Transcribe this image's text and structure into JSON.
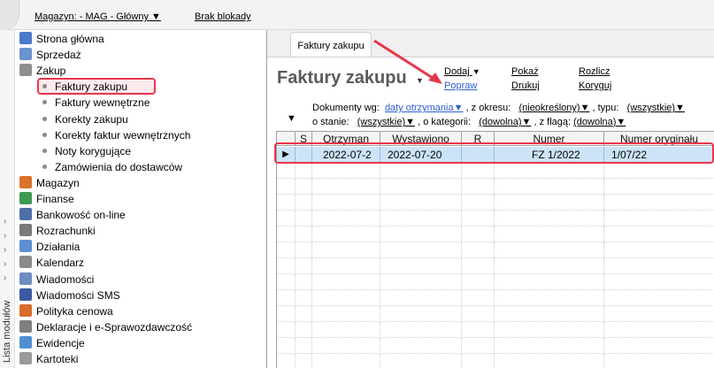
{
  "topbar": {
    "warehouse": "Magazyn: - MAG - Główny",
    "lock_status": "Brak blokady"
  },
  "sidebar": {
    "vertical_label": "Lista modułów",
    "items": [
      {
        "label": "Strona główna",
        "icon": "home-icon",
        "color": "#4a79c9"
      },
      {
        "label": "Sprzedaż",
        "icon": "sales-icon",
        "color": "#6b93cf"
      },
      {
        "label": "Zakup",
        "icon": "purchase-icon",
        "color": "#8f8f8f"
      },
      {
        "label": "Faktury zakupu",
        "child": true,
        "selected": true
      },
      {
        "label": "Faktury wewnętrzne",
        "child": true
      },
      {
        "label": "Korekty zakupu",
        "child": true
      },
      {
        "label": "Korekty faktur wewnętrznych",
        "child": true
      },
      {
        "label": "Noty korygujące",
        "child": true
      },
      {
        "label": "Zamówienia do dostawców",
        "child": true
      },
      {
        "label": "Magazyn",
        "icon": "warehouse-icon",
        "color": "#d9732c"
      },
      {
        "label": "Finanse",
        "icon": "finance-icon",
        "color": "#3d9a52"
      },
      {
        "label": "Bankowość on-line",
        "icon": "bank-icon",
        "color": "#4f6fa8"
      },
      {
        "label": "Rozrachunki",
        "icon": "settlements-icon",
        "color": "#7a7a7a"
      },
      {
        "label": "Działania",
        "icon": "actions-icon",
        "color": "#5b8fd0"
      },
      {
        "label": "Kalendarz",
        "icon": "calendar-icon",
        "color": "#8a8a8a"
      },
      {
        "label": "Wiadomości",
        "icon": "messages-icon",
        "color": "#6c8cc2"
      },
      {
        "label": "Wiadomości SMS",
        "icon": "sms-icon",
        "color": "#3b5aa0"
      },
      {
        "label": "Polityka cenowa",
        "icon": "pricing-icon",
        "color": "#d96b2c"
      },
      {
        "label": "Deklaracje i e-Sprawozdawczość",
        "icon": "declarations-icon",
        "color": "#7f7f7f"
      },
      {
        "label": "Ewidencje",
        "icon": "records-icon",
        "color": "#4f8fd0"
      },
      {
        "label": "Kartoteki",
        "icon": "files-icon",
        "color": "#9a9a9a"
      }
    ]
  },
  "tab": {
    "label": "Faktury zakupu"
  },
  "main": {
    "title": "Faktury zakupu",
    "actions": {
      "dodaj": "Dodaj",
      "popraw": "Popraw",
      "pokaz": "Pokaż",
      "drukuj": "Drukuj",
      "rozlicz": "Rozlicz",
      "koryguj": "Koryguj"
    },
    "filters": {
      "documents_by_label": "Dokumenty wg:",
      "documents_by_value": "daty otrzymania",
      "period_label": ", z okresu:",
      "period_value": "(nieokreślony)",
      "type_label": ", typu:",
      "type_value": "(wszystkie)",
      "state_label": "o stanie:",
      "state_value": "(wszystkie)",
      "category_label": ", o kategorii:",
      "category_value": "(dowolna)",
      "flag_label": ", z flagą:",
      "flag_value": "(dowolna)"
    }
  },
  "grid": {
    "columns": [
      "S",
      "Otrzyman",
      "Wystawiono",
      "R",
      "Numer",
      "Numer oryginału"
    ],
    "rows": [
      [
        "",
        "2022-07-2",
        "2022-07-20",
        "",
        "FZ 1/2022",
        "1/07/22"
      ]
    ],
    "row_pointer": "▶"
  },
  "colors": {
    "highlight": "#e8374a",
    "link": "#2f5fd0",
    "row_selected": "#cde4f8"
  }
}
